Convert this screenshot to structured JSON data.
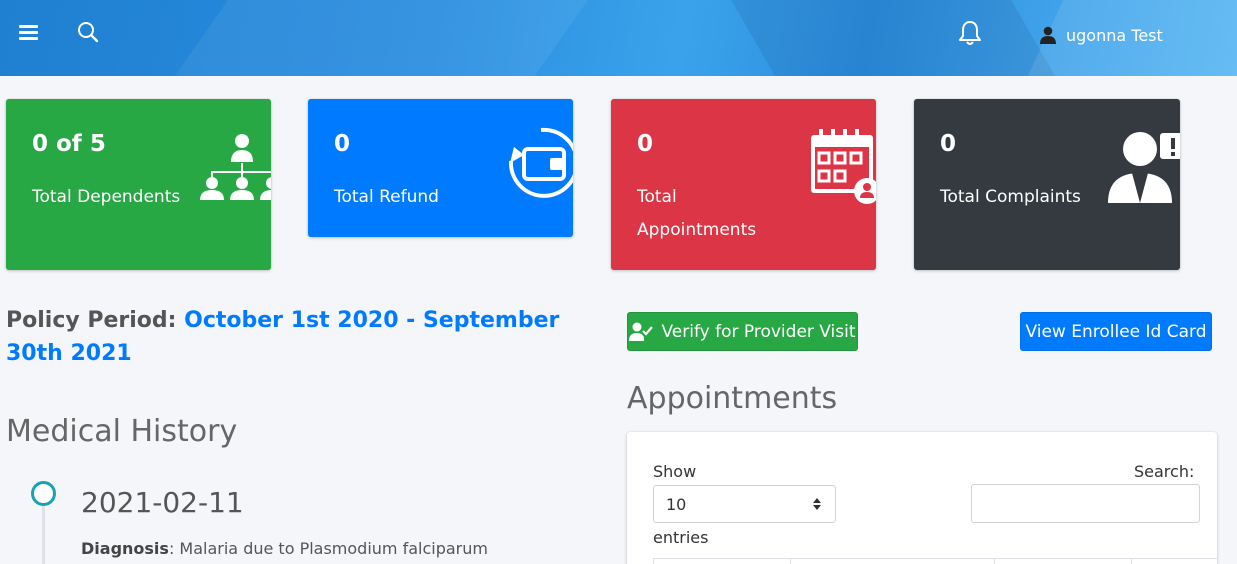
{
  "header": {
    "user_name": "ugonna Test",
    "icons": [
      "menu-icon",
      "search-icon",
      "bell-icon",
      "user-icon"
    ]
  },
  "stats": [
    {
      "value": "0 of 5",
      "label": "Total Dependents",
      "color": "#28a745",
      "icon": "dependents-tree-icon"
    },
    {
      "value": "0",
      "label": "Total Refund",
      "color": "#007bff",
      "icon": "wallet-refund-icon"
    },
    {
      "value": "0",
      "label": "Total Appointments",
      "color": "#dc3545",
      "icon": "calendar-user-icon"
    },
    {
      "value": "0",
      "label": "Total Complaints",
      "color": "#343a40",
      "icon": "user-complaint-icon"
    }
  ],
  "policy": {
    "label": "Policy Period:",
    "period": "October 1st 2020 - September 30th 2021"
  },
  "actions": {
    "verify_label": "Verify for Provider Visit",
    "idcard_label": "View Enrollee Id Card"
  },
  "appointments": {
    "title": "Appointments",
    "show_label": "Show",
    "page_size": "10",
    "entries_label": "entries",
    "search_label": "Search:",
    "search_value": ""
  },
  "medical_history": {
    "title": "Medical History",
    "items": [
      {
        "date": "2021-02-11",
        "diagnosis_label": "Diagnosis",
        "diagnosis": "Malaria due to Plasmodium falciparum"
      }
    ]
  },
  "colors": {
    "accent": "#007bff",
    "success": "#28a745",
    "danger": "#dc3545",
    "dark": "#343a40",
    "timeline_dot": "#17a2b8"
  }
}
